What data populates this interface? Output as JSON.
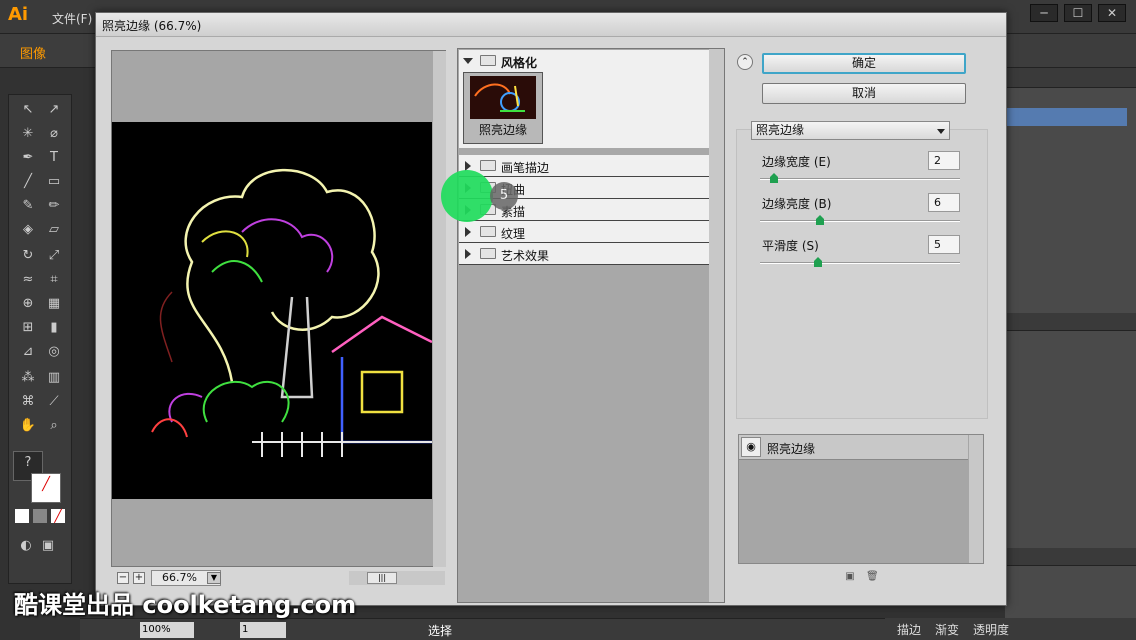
{
  "app": {
    "logo": "Ai",
    "menu_file": "文件(F)",
    "control_label": "图像",
    "window_buttons": [
      "─",
      "☐",
      "✕"
    ],
    "status": {
      "zoom": "100%",
      "page": "1",
      "tool": "选择"
    },
    "panel_tabs": [
      "描边",
      "渐变",
      "透明度"
    ]
  },
  "dialog": {
    "title": "照亮边缘 (66.7%)",
    "preview": {
      "zoom": "66.7%"
    },
    "categories": [
      {
        "label": "风格化",
        "expanded": true,
        "thumbnail_label": "照亮边缘"
      },
      {
        "label": "画笔描边",
        "expanded": false
      },
      {
        "label": "扭曲",
        "expanded": false
      },
      {
        "label": "素描",
        "expanded": false
      },
      {
        "label": "纹理",
        "expanded": false
      },
      {
        "label": "艺术效果",
        "expanded": false
      }
    ],
    "buttons": {
      "ok": "确定",
      "cancel": "取消"
    },
    "filter_select": "照亮边缘",
    "params": [
      {
        "label": "边缘宽度 (E)",
        "value": "2",
        "fraction": 0.07
      },
      {
        "label": "边缘亮度 (B)",
        "value": "6",
        "fraction": 0.3
      },
      {
        "label": "平滑度 (S)",
        "value": "5",
        "fraction": 0.29
      }
    ],
    "effect_layer": {
      "label": "照亮边缘"
    }
  },
  "cursor": {
    "click_count": "5"
  },
  "watermark": "酷课堂出品 coolketang.com",
  "colors": {
    "accent_orange": "#ff9a00",
    "default_button_border": "#3fa5c8",
    "cursor_halo": "#1fdc5c"
  }
}
